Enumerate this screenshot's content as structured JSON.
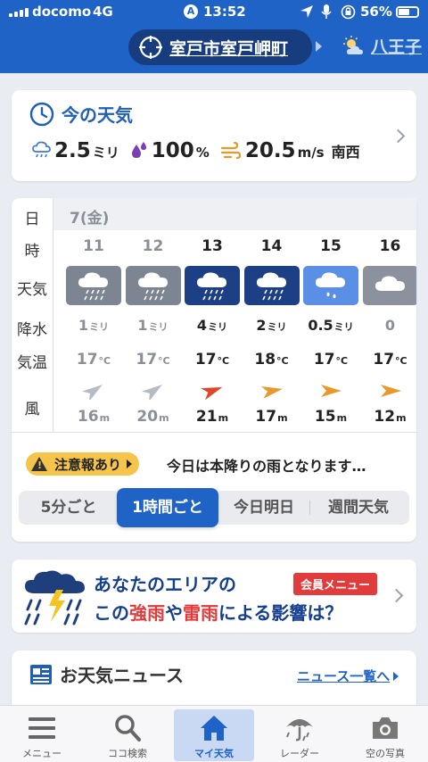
{
  "status": {
    "carrier": "docomo",
    "network": "4G",
    "time": "13:52",
    "battery": "56%"
  },
  "header": {
    "location": "室戸市室戸岬町",
    "next_location": "八王子"
  },
  "now": {
    "title": "今の天気",
    "precip_value": "2.5",
    "precip_unit": "ミリ",
    "humidity_value": "100",
    "humidity_unit": "%",
    "wind_value": "20.5",
    "wind_unit": "m/s",
    "wind_dir": "南西"
  },
  "forecast": {
    "labels": {
      "day": "日",
      "hour": "時",
      "weather": "天気",
      "rain": "降水",
      "temp": "気温",
      "wind": "風"
    },
    "date": "7(金)",
    "rain_unit": "ミリ",
    "temp_unit": "°C",
    "wind_unit": "m",
    "hours": [
      {
        "hour": "11",
        "weather": "rain-cloud-icon",
        "rain": "1",
        "temp": "17",
        "wind": "16",
        "past": true
      },
      {
        "hour": "12",
        "weather": "rain-cloud-icon",
        "rain": "1",
        "temp": "17",
        "wind": "20",
        "past": true
      },
      {
        "hour": "13",
        "weather": "rain-cloud-icon",
        "rain": "4",
        "temp": "17",
        "wind": "21",
        "past": false
      },
      {
        "hour": "14",
        "weather": "rain-cloud-icon",
        "rain": "2",
        "temp": "18",
        "wind": "17",
        "past": false
      },
      {
        "hour": "15",
        "weather": "light-rain-cloud-icon",
        "rain": "0.5",
        "temp": "17",
        "wind": "15",
        "past": false
      },
      {
        "hour": "16",
        "weather": "cloud-icon",
        "rain": "0",
        "temp": "17",
        "wind": "12",
        "past": false
      }
    ],
    "warning_label": "注意報あり",
    "warning_message": "今日は本降りの雨となります…",
    "tabs": [
      "5分ごと",
      "1時間ごと",
      "今日明日",
      "週間天気"
    ],
    "active_tab": "1時間ごと"
  },
  "banner": {
    "line1": "あなたのエリアの",
    "badge": "会員メニュー",
    "line2_a": "この",
    "line2_b": "強雨",
    "line2_c": "や",
    "line2_d": "雷雨",
    "line2_e": "による影響は？"
  },
  "news": {
    "title": "お天気ニュース",
    "link": "ニュース一覧へ"
  },
  "tabbar": [
    {
      "label": "メニュー",
      "icon": "menu-icon"
    },
    {
      "label": "ココ検索",
      "icon": "search-icon"
    },
    {
      "label": "マイ天気",
      "icon": "home-icon",
      "active": true
    },
    {
      "label": "レーダー",
      "icon": "radar-umbrella-icon"
    },
    {
      "label": "空の写真",
      "icon": "camera-icon"
    }
  ],
  "colors": {
    "brand": "#1f63c6",
    "brand_dark": "#173d7e",
    "cell_dark": "#1d3f86",
    "cell_light": "#5b8fe6",
    "cell_grey": "#7d8592",
    "warning": "#f4c54a",
    "alert_red": "#e23b3b"
  }
}
